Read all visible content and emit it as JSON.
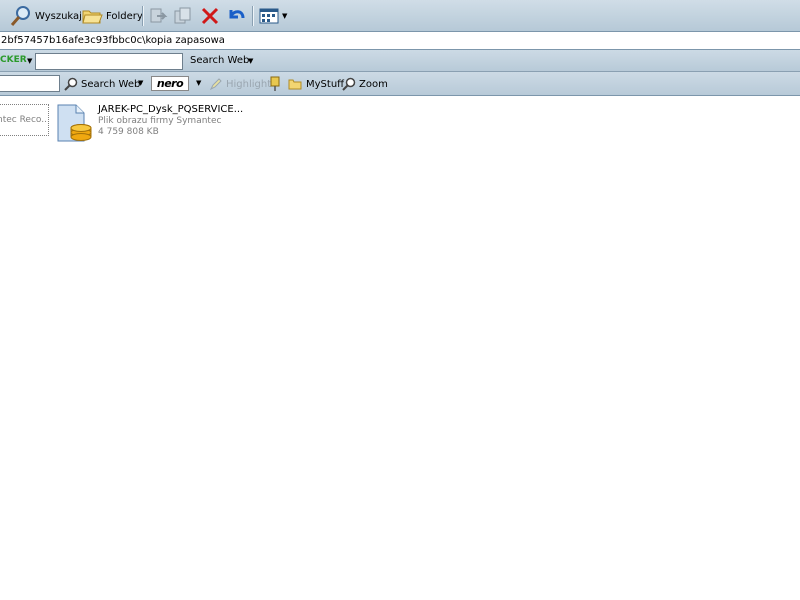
{
  "toolbar": {
    "search_label": "Wyszukaj",
    "folders_label": "Foldery"
  },
  "address": {
    "path": "2bf57457b16afe3c93fbbc0c\\kopia zapasowa"
  },
  "webbar": {
    "brand_partial": "CKER",
    "search_web_label": "Search Web",
    "search_value": ""
  },
  "nerobar": {
    "search_value": "",
    "search_web_label": "Search Web",
    "nero_logo": "nero",
    "highlight_label": "Highlight",
    "mystuff_label": "MyStuff",
    "zoom_label": "Zoom"
  },
  "files": {
    "partial_label": "ntec Reco...",
    "item": {
      "name": "JAREK-PC_Dysk_PQSERVICE...",
      "type": "Plik obrazu firmy Symantec",
      "size": "4 759 808 KB"
    }
  },
  "colors": {
    "toolbar_bg": "#c3d3df",
    "brand_green": "#2a9a2a",
    "delete_red": "#d01818",
    "undo_blue": "#1a5fc8"
  }
}
